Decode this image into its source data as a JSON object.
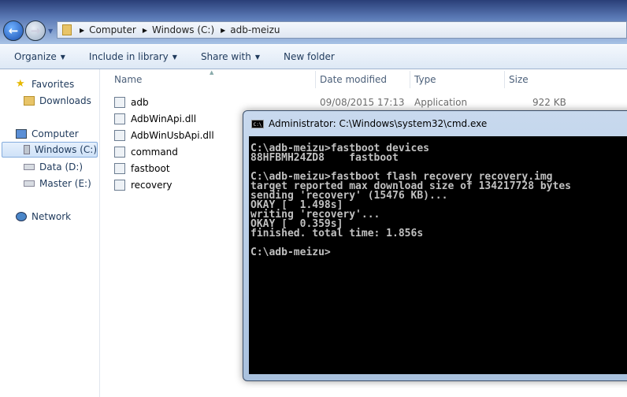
{
  "breadcrumb": [
    "Computer",
    "Windows (C:)",
    "adb-meizu"
  ],
  "toolbar": {
    "organize": "Organize",
    "include": "Include in library",
    "share": "Share with",
    "new_folder": "New folder"
  },
  "sidebar": {
    "favorites": "Favorites",
    "downloads": "Downloads",
    "computer": "Computer",
    "windows": "Windows (C:)",
    "data": "Data (D:)",
    "master": "Master (E:)",
    "network": "Network"
  },
  "columns": {
    "name": "Name",
    "date": "Date modified",
    "type": "Type",
    "size": "Size"
  },
  "files": [
    {
      "name": "adb",
      "date": "09/08/2015 17:13",
      "type": "Application",
      "size": "922 KB"
    },
    {
      "name": "AdbWinApi.dll"
    },
    {
      "name": "AdbWinUsbApi.dll"
    },
    {
      "name": "command"
    },
    {
      "name": "fastboot"
    },
    {
      "name": "recovery"
    }
  ],
  "cmd": {
    "title": "Administrator: C:\\Windows\\system32\\cmd.exe",
    "icon_text": "C:\\",
    "lines": [
      "C:\\adb-meizu>fastboot devices",
      "88HFBMH24ZD8    fastboot",
      "",
      "C:\\adb-meizu>fastboot flash recovery recovery.img",
      "target reported max download size of 134217728 bytes",
      "sending 'recovery' (15476 KB)...",
      "OKAY [  1.498s]",
      "writing 'recovery'...",
      "OKAY [  0.359s]",
      "finished. total time: 1.856s",
      "",
      "C:\\adb-meizu>"
    ]
  }
}
